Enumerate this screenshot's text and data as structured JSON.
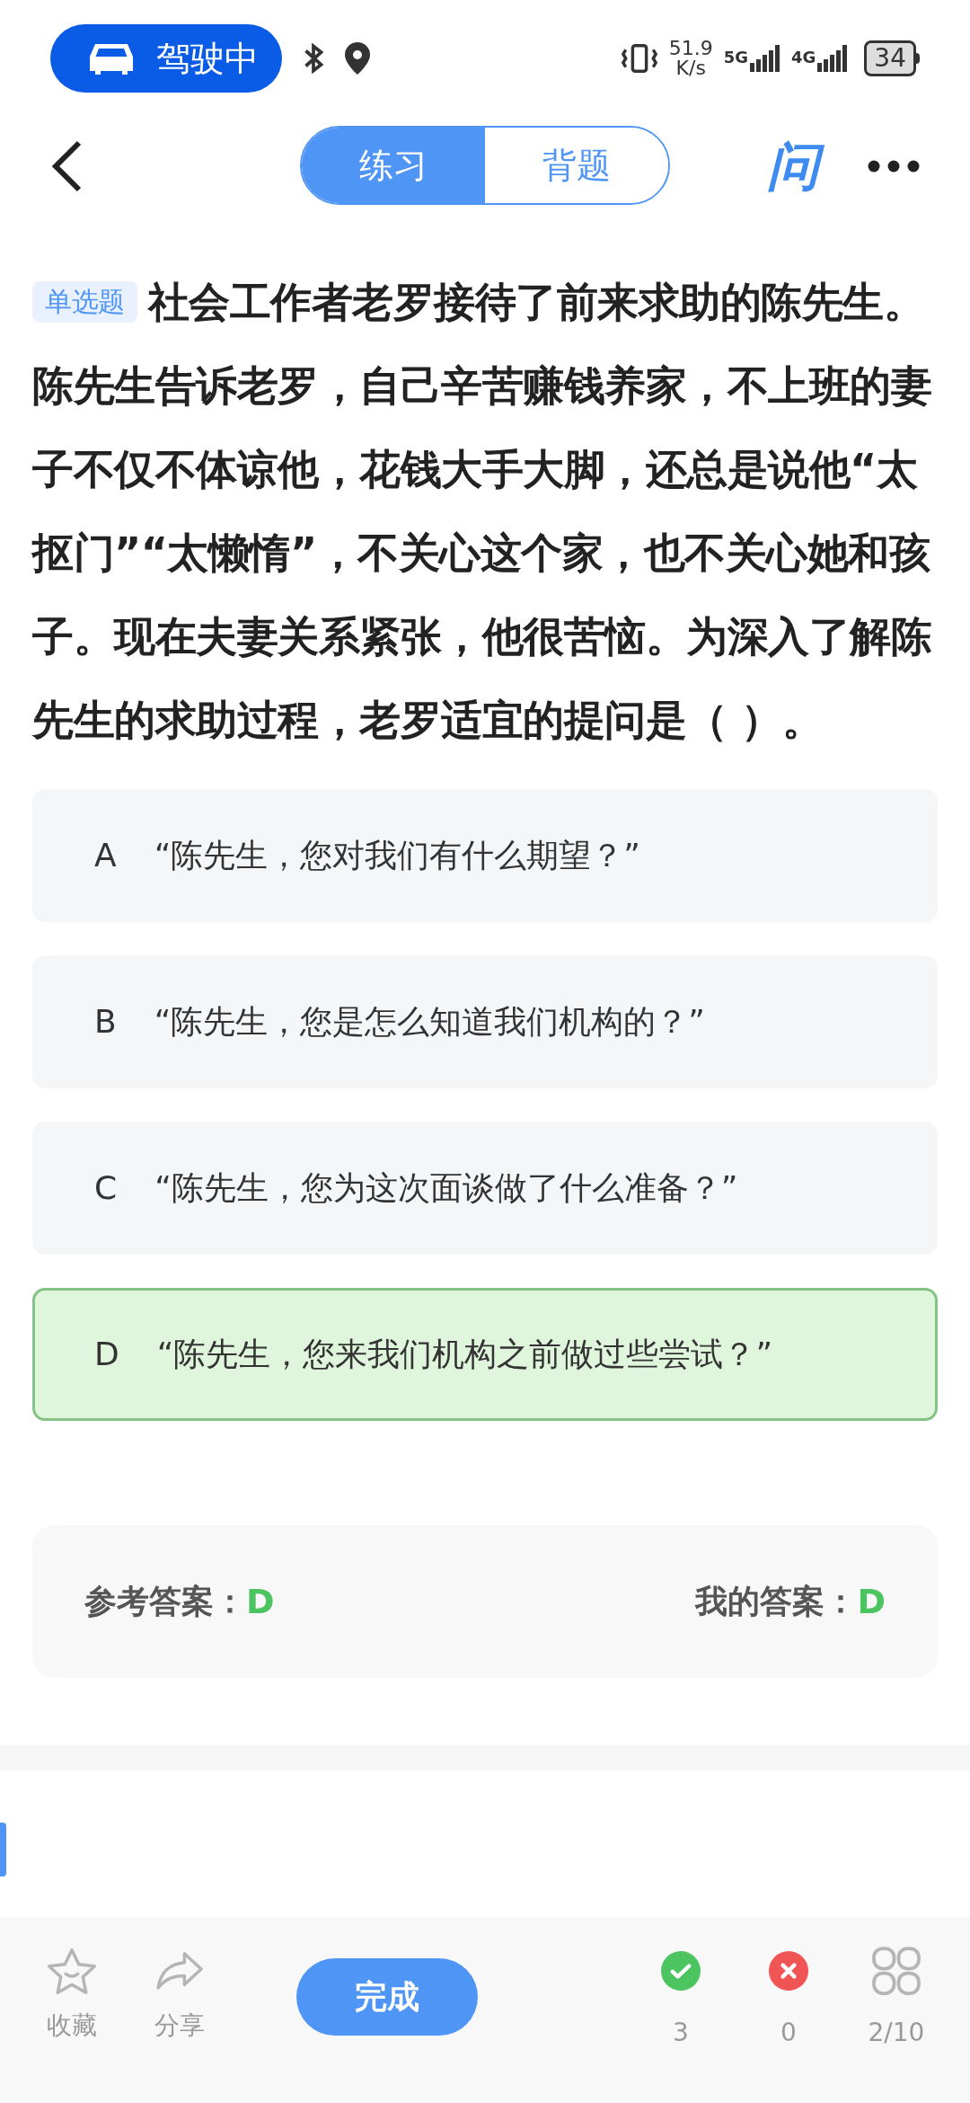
{
  "status_bar": {
    "driving_label": "驾驶中",
    "net_speed_value": "51.9",
    "net_speed_unit": "K/s",
    "networks": [
      "5G",
      "4G"
    ],
    "battery": "34"
  },
  "header": {
    "tabs": [
      {
        "label": "练习",
        "selected": true
      },
      {
        "label": "背题",
        "selected": false
      }
    ],
    "ask_label": "问"
  },
  "question": {
    "type_badge": "单选题",
    "text": "社会工作者老罗接待了前来求助的陈先生。陈先生告诉老罗，自己辛苦赚钱养家，不上班的妻子不仅不体谅他，花钱大手大脚，还总是说他“太抠门”“太懒惰”，不关心这个家，也不关心她和孩子。现在夫妻关系紧张，他很苦恼。为深入了解陈先生的求助过程，老罗适宜的提问是（ ）。"
  },
  "options": [
    {
      "letter": "A",
      "text": "“陈先生，您对我们有什么期望？”",
      "selected": false
    },
    {
      "letter": "B",
      "text": "“陈先生，您是怎么知道我们机构的？”",
      "selected": false
    },
    {
      "letter": "C",
      "text": "“陈先生，您为这次面谈做了什么准备？”",
      "selected": false
    },
    {
      "letter": "D",
      "text": "“陈先生，您来我们机构之前做过些尝试？”",
      "selected": true
    }
  ],
  "answer": {
    "reference_label": "参考答案：",
    "reference": "D",
    "mine_label": "我的答案：",
    "mine": "D"
  },
  "bottom_bar": {
    "actions": [
      {
        "kind": "favorite",
        "label": "收藏"
      },
      {
        "kind": "share",
        "label": "分享"
      }
    ],
    "finish": "完成",
    "stats": [
      {
        "kind": "correct",
        "value": "3"
      },
      {
        "kind": "wrong",
        "value": "0"
      },
      {
        "kind": "progress",
        "value": "2/10"
      }
    ]
  }
}
